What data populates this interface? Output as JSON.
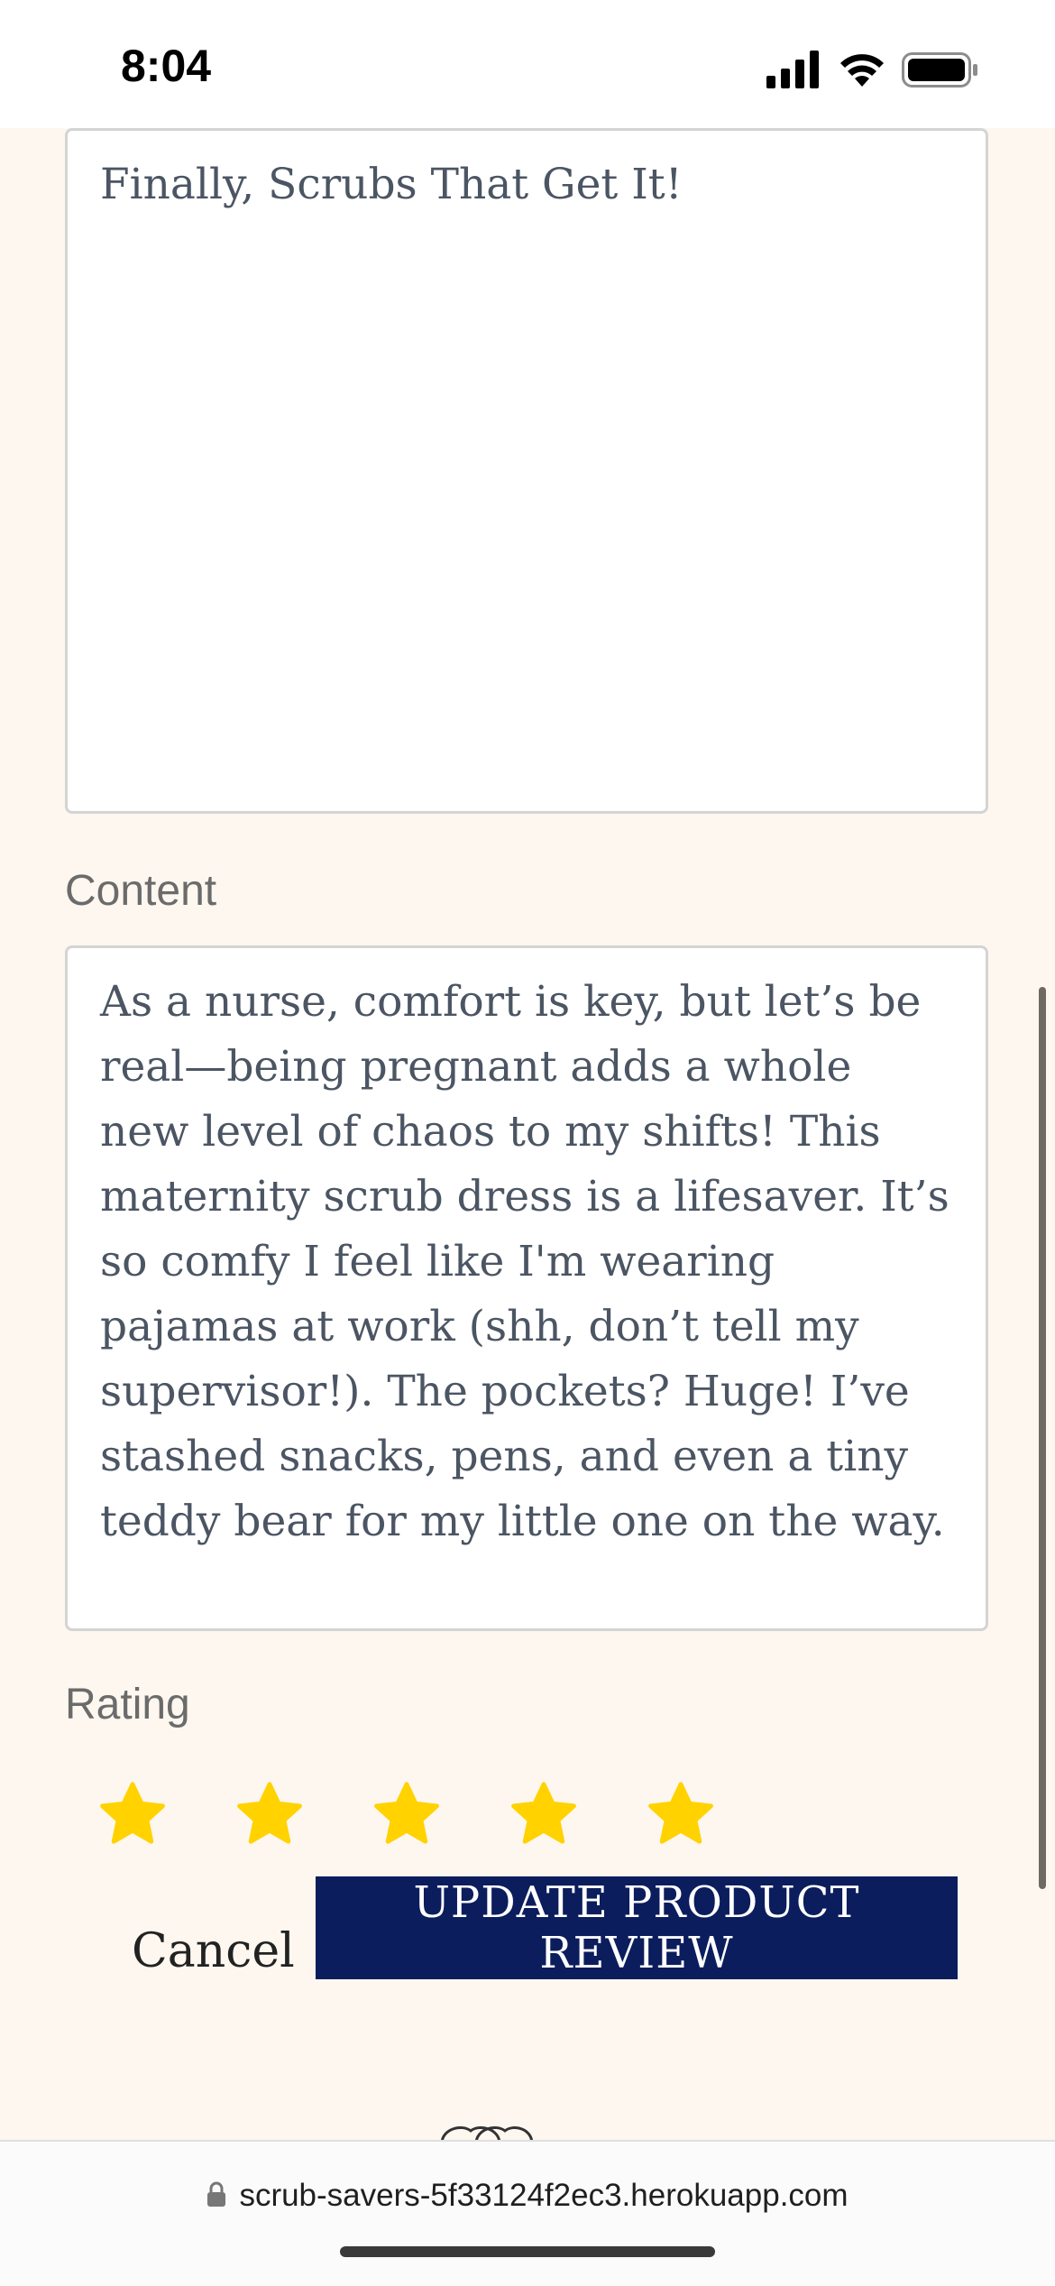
{
  "status_bar": {
    "time": "8:04",
    "icons": [
      "signal-icon",
      "wifi-icon",
      "battery-icon"
    ]
  },
  "form": {
    "title_value": "Finally, Scrubs That Get It!",
    "content_label": "Content",
    "content_value": "As a nurse, comfort is key, but let’s be real—being pregnant adds a whole new level of chaos to my shifts! This maternity scrub dress is a lifesaver. It’s so comfy I feel like I'm wearing pajamas at work (shh, don’t tell my supervisor!). The pockets? Huge! I’ve stashed snacks, pens, and even a tiny teddy bear for my little one on the way.",
    "rating_label": "Rating",
    "rating_value": 5,
    "rating_max": 5,
    "star_color": "#FFD200",
    "cancel_label": "Cancel",
    "submit_label": "UPDATE PRODUCT REVIEW",
    "submit_color": "#0B1D5C"
  },
  "browser": {
    "url": "scrub-savers-5f33124f2ec3.herokuapp.com"
  }
}
